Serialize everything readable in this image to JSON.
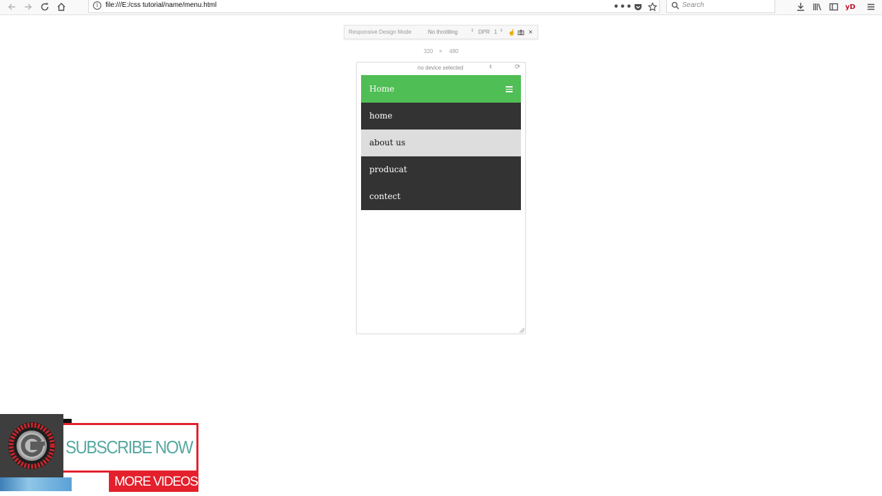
{
  "browser": {
    "url": "file:///E:/css tutorial/name/menu.html",
    "search_placeholder": "Search",
    "profile_badge": "yD"
  },
  "rdm": {
    "title": "Responsive Design Mode",
    "throttling": "No throttling",
    "dpr_label": "DPR",
    "dpr_value": "1",
    "width": "320",
    "times": "×",
    "height": "480",
    "device": "no device selected"
  },
  "site": {
    "header_title": "Home",
    "accent_color": "#4fbe54",
    "menu_items": [
      {
        "label": "home"
      },
      {
        "label": "about us"
      },
      {
        "label": "producat"
      },
      {
        "label": "contect"
      }
    ]
  },
  "overlay": {
    "subscribe": "SUBSCRIBE NOW",
    "more": "MORE VIDEOS",
    "brand_color": "#e3202b"
  }
}
